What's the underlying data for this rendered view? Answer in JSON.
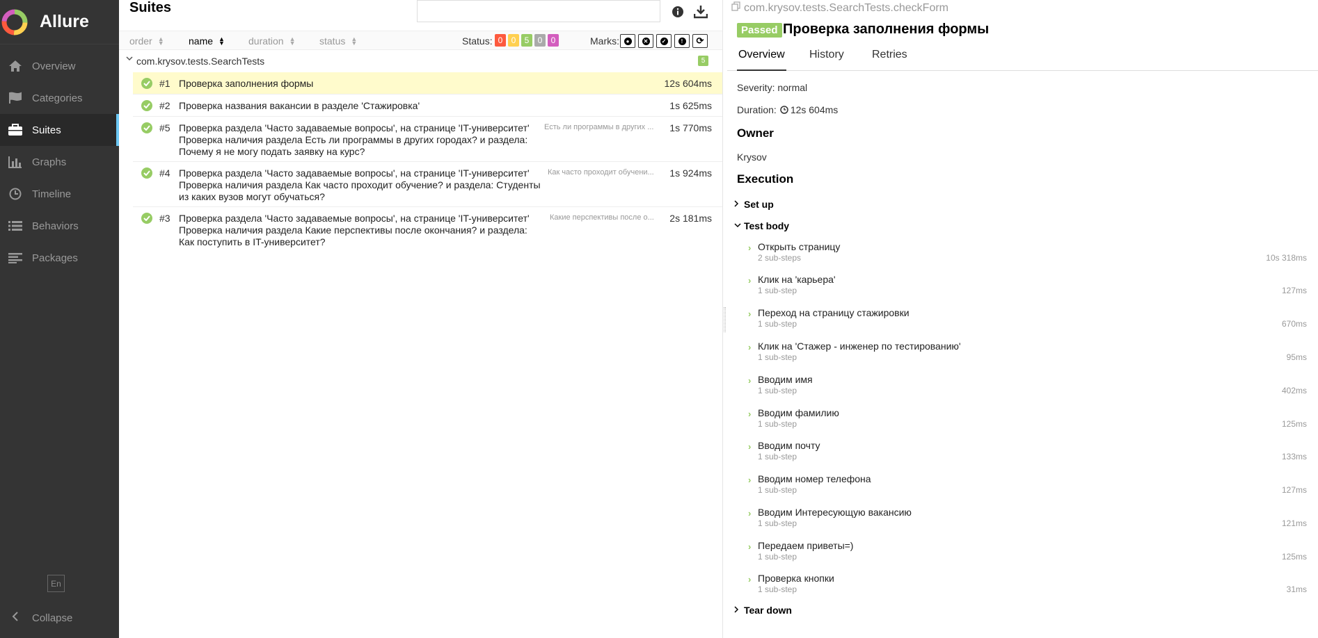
{
  "app": {
    "name": "Allure",
    "lang": "En",
    "collapse_label": "Collapse"
  },
  "sidebar": {
    "items": [
      {
        "label": "Overview",
        "icon": "home-icon"
      },
      {
        "label": "Categories",
        "icon": "flag-icon"
      },
      {
        "label": "Suites",
        "icon": "briefcase-icon",
        "active": true
      },
      {
        "label": "Graphs",
        "icon": "bar-chart-icon"
      },
      {
        "label": "Timeline",
        "icon": "clock-icon"
      },
      {
        "label": "Behaviors",
        "icon": "list-icon"
      },
      {
        "label": "Packages",
        "icon": "align-left-icon"
      }
    ]
  },
  "tree": {
    "title": "Suites",
    "search": {
      "placeholder": "",
      "value": ""
    },
    "sort": {
      "order": "order",
      "name": "name",
      "duration": "duration",
      "status": "status"
    },
    "status_label": "Status:",
    "status_counts": [
      {
        "value": "0",
        "color": "#fd5a3e"
      },
      {
        "value": "0",
        "color": "#ffd050"
      },
      {
        "value": "5",
        "color": "#97cc64"
      },
      {
        "value": "0",
        "color": "#aaaaaa"
      },
      {
        "value": "0",
        "color": "#d35ebe"
      }
    ],
    "marks_label": "Marks:",
    "group": {
      "name": "com.krysov.tests.SearchTests",
      "count": "5"
    },
    "rows": [
      {
        "num": "#1",
        "name": [
          "Проверка заполнения формы"
        ],
        "param": "",
        "duration": "12s 604ms",
        "selected": true
      },
      {
        "num": "#2",
        "name": [
          "Проверка названия вакансии в разделе 'Стажировка'"
        ],
        "param": "",
        "duration": "1s 625ms"
      },
      {
        "num": "#5",
        "name": [
          "Проверка раздела 'Часто задаваемые вопросы', на странице 'IT-университет'",
          "Проверка наличия раздела Есть ли программы в других городах? и раздела:",
          "Почему я не могу подать заявку на курс?"
        ],
        "param": "Есть ли программы в других ...",
        "duration": "1s 770ms"
      },
      {
        "num": "#4",
        "name": [
          "Проверка раздела 'Часто задаваемые вопросы', на странице 'IT-университет'",
          "Проверка наличия раздела Как часто проходит обучение? и раздела: Студенты",
          "из каких вузов могут обучаться?"
        ],
        "param": "Как часто проходит обучени...",
        "duration": "1s 924ms"
      },
      {
        "num": "#3",
        "name": [
          "Проверка раздела 'Часто задаваемые вопросы', на странице 'IT-университет'",
          "Проверка наличия раздела Какие перспективы после окончания? и раздела:",
          "Как поступить в IT-университет?"
        ],
        "param": "Какие перспективы после о...",
        "duration": "2s 181ms"
      }
    ]
  },
  "details": {
    "path": "com.krysov.tests.SearchTests.checkForm",
    "status": "Passed",
    "title": "Проверка заполнения формы",
    "tabs": [
      "Overview",
      "History",
      "Retries"
    ],
    "severity": "Severity: normal",
    "duration_label": "Duration:",
    "duration_value": "12s 604ms",
    "owner_heading": "Owner",
    "owner": "Krysov",
    "execution_heading": "Execution",
    "setup_label": "Set up",
    "body_label": "Test body",
    "teardown_label": "Tear down",
    "steps": [
      {
        "title": "Открыть страницу",
        "sub": "2 sub-steps",
        "duration": "10s 318ms"
      },
      {
        "title": "Клик на 'карьера'",
        "sub": "1 sub-step",
        "duration": "127ms"
      },
      {
        "title": "Переход на страницу стажировки",
        "sub": "1 sub-step",
        "duration": "670ms"
      },
      {
        "title": "Клик на 'Стажер - инженер по тестированию'",
        "sub": "1 sub-step",
        "duration": "95ms"
      },
      {
        "title": "Вводим имя",
        "sub": "1 sub-step",
        "duration": "402ms"
      },
      {
        "title": "Вводим фамилию",
        "sub": "1 sub-step",
        "duration": "125ms"
      },
      {
        "title": "Вводим почту",
        "sub": "1 sub-step",
        "duration": "133ms"
      },
      {
        "title": "Вводим номер телефона",
        "sub": "1 sub-step",
        "duration": "127ms"
      },
      {
        "title": "Вводим Интересующую вакансию",
        "sub": "1 sub-step",
        "duration": "121ms"
      },
      {
        "title": "Передаем приветы=)",
        "sub": "1 sub-step",
        "duration": "125ms"
      },
      {
        "title": "Проверка кнопки",
        "sub": "1 sub-step",
        "duration": "31ms"
      }
    ]
  }
}
